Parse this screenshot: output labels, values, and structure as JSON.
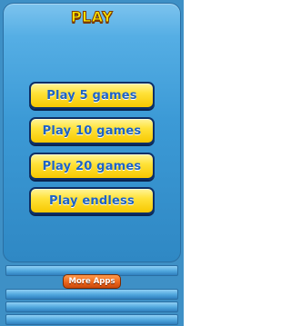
{
  "screen": {
    "title": "PLAY"
  },
  "menu": {
    "buttons": [
      {
        "label": "Play 5 games"
      },
      {
        "label": "Play 10 games"
      },
      {
        "label": "Play 20 games"
      },
      {
        "label": "Play endless"
      }
    ]
  },
  "footer": {
    "more_apps_label": "More Apps"
  },
  "colors": {
    "background": "#3e90c6",
    "button_fill": "#ffe23a",
    "button_text": "#1e63c4",
    "title_text": "#ffe600",
    "more_apps_fill": "#e9621a"
  }
}
